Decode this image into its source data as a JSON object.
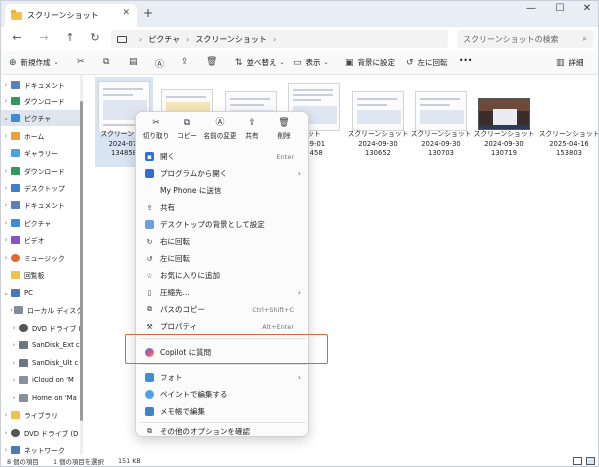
{
  "window": {
    "tab_title": "スクリーンショット",
    "new_tab": "+",
    "controls": [
      "—",
      "☐",
      "✕"
    ]
  },
  "address": {
    "crumbs": [
      "ピクチャ",
      "スクリーンショット"
    ],
    "search_placeholder": "スクリーンショットの検索"
  },
  "toolbar": {
    "new": "新規作成",
    "sort": "並べ替え",
    "view": "表示",
    "set_background": "背景に設定",
    "rotate_left": "左に回転",
    "more": "•••",
    "details": "詳細"
  },
  "sidebar": {
    "items": [
      {
        "label": "ドキュメント"
      },
      {
        "label": "ダウンロード"
      },
      {
        "label": "ピクチャ"
      },
      {
        "label": "ホーム"
      },
      {
        "label": "ギャラリー"
      },
      {
        "label": "ダウンロード"
      },
      {
        "label": "デスクトップ"
      },
      {
        "label": "ドキュメント"
      },
      {
        "label": "ピクチャ"
      },
      {
        "label": "ビデオ"
      },
      {
        "label": "ミュージック"
      },
      {
        "label": "回覧板"
      },
      {
        "label": "PC"
      },
      {
        "label": "ローカル ディスク"
      },
      {
        "label": "DVD ドライブ ("
      },
      {
        "label": "SanDisk_Ext c"
      },
      {
        "label": "SanDisk_Ult c"
      },
      {
        "label": "iCloud on 'M"
      },
      {
        "label": "Home on 'Ma"
      },
      {
        "label": "ライブラリ"
      },
      {
        "label": "DVD ドライブ (D"
      },
      {
        "label": "ネットワーク"
      }
    ]
  },
  "files": [
    {
      "line1": "スクリーンショ",
      "line2": "2024-07-",
      "line3": "134858"
    },
    {
      "line1": "",
      "line2": "",
      "line3": ""
    },
    {
      "line1": "",
      "line2": "",
      "line3": ""
    },
    {
      "line1": "ット",
      "line2": "-09-01",
      "line3": "5458"
    },
    {
      "line1": "スクリーンショット",
      "line2": "2024-09-30",
      "line3": "130652"
    },
    {
      "line1": "スクリーンショット",
      "line2": "2024-09-30",
      "line3": "130703"
    },
    {
      "line1": "スクリーンショット",
      "line2": "2024-09-30",
      "line3": "130719"
    },
    {
      "line1": "スクリーンショット",
      "line2": "2025-04-16",
      "line3": "153803"
    }
  ],
  "context_menu": {
    "quick_actions": [
      "切り取り",
      "コピー",
      "名前の変更",
      "共有",
      "削除"
    ],
    "items": [
      {
        "label": "開く",
        "shortcut": "Enter",
        "arrow": ""
      },
      {
        "label": "プログラムから開く",
        "shortcut": "",
        "arrow": "›"
      },
      {
        "label": "My Phone に送信",
        "shortcut": "",
        "arrow": ""
      },
      {
        "label": "共有",
        "shortcut": "",
        "arrow": ""
      },
      {
        "label": "デスクトップの背景として設定",
        "shortcut": "",
        "arrow": ""
      },
      {
        "label": "右に回転",
        "shortcut": "",
        "arrow": ""
      },
      {
        "label": "左に回転",
        "shortcut": "",
        "arrow": ""
      },
      {
        "label": "お気に入りに追加",
        "shortcut": "",
        "arrow": ""
      },
      {
        "label": "圧縮先...",
        "shortcut": "",
        "arrow": "›"
      },
      {
        "label": "パスのコピー",
        "shortcut": "Ctrl+Shift+C",
        "arrow": ""
      },
      {
        "label": "プロパティ",
        "shortcut": "Alt+Enter",
        "arrow": ""
      },
      {
        "label": "Copilot に質問",
        "shortcut": "",
        "arrow": ""
      },
      {
        "label": "フォト",
        "shortcut": "",
        "arrow": "›"
      },
      {
        "label": "ペイントで編集する",
        "shortcut": "",
        "arrow": ""
      },
      {
        "label": "メモ帳で編集",
        "shortcut": "",
        "arrow": ""
      },
      {
        "label": "その他のオプションを確認",
        "shortcut": "",
        "arrow": ""
      }
    ]
  },
  "status": {
    "count": "8 個の項目",
    "selection": "1 個の項目を選択",
    "size": "151 KB"
  }
}
